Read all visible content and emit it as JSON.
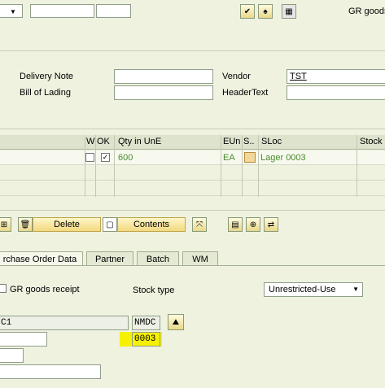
{
  "toolbar": {
    "gr_label": "GR goods"
  },
  "header": {
    "delivery_note_label": "Delivery Note",
    "bill_of_lading_label": "Bill of Lading",
    "vendor_label": "Vendor",
    "vendor_value": "TST",
    "header_text_label": "HeaderText"
  },
  "table": {
    "columns": [
      "W",
      "OK",
      "Qty in UnE",
      "EUn",
      "S..",
      "SLoc",
      "Stock"
    ],
    "row": {
      "qty": "600",
      "eun": "EA",
      "sloc": "Lager 0003"
    }
  },
  "buttons": {
    "delete": "Delete",
    "contents": "Contents"
  },
  "tabs": [
    "rchase Order Data",
    "Partner",
    "Batch",
    "WM"
  ],
  "detail": {
    "gr_goods_receipt_label": "GR goods receipt",
    "stock_type_label": "Stock type",
    "stock_type_value": "Unrestricted-Use",
    "plant_partial": "C1",
    "plant_name": "NMDC",
    "sloc_value": "0003"
  },
  "colors": {
    "background": "#eef2df",
    "highlight": "#f5f100",
    "row_text": "#4a8a2c"
  }
}
